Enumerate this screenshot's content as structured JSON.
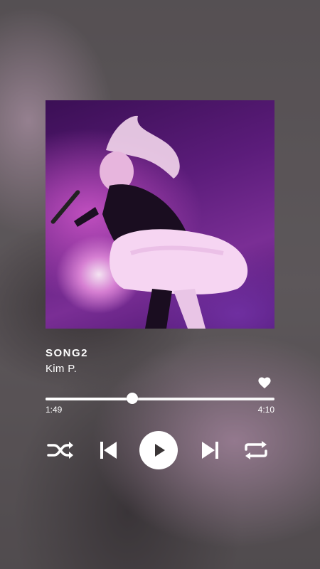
{
  "song": {
    "title": "SONG2",
    "artist": "Kim P."
  },
  "player": {
    "current_time": "1:49",
    "total_time": "4:10",
    "progress": 0.38,
    "favorited": true
  },
  "controls": {
    "shuffle_icon": "shuffle-icon",
    "previous_icon": "skip-previous-icon",
    "play_icon": "play-icon",
    "next_icon": "skip-next-icon",
    "repeat_icon": "repeat-icon",
    "heart_icon": "heart-icon"
  },
  "colors": {
    "accent": "#ffffff",
    "play_glyph": "#3a3536"
  }
}
